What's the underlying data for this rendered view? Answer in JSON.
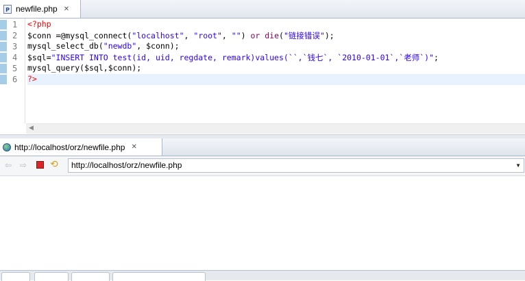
{
  "editor": {
    "tab_label": "newfile.php",
    "line_numbers": [
      "1",
      "2",
      "3",
      "4",
      "5",
      "6"
    ],
    "code": {
      "l1_tag": "<?php",
      "l2_a": "$conn =@mysql_connect(",
      "l2_s1": "\"localhost\"",
      "l2_b": ", ",
      "l2_s2": "\"root\"",
      "l2_c": ", ",
      "l2_s3": "\"\"",
      "l2_d": ") ",
      "l2_kw": "or die",
      "l2_e": "(",
      "l2_s4": "\"链接错误\"",
      "l2_f": ");",
      "l3_a": "mysql_select_db(",
      "l3_s1": "\"newdb\"",
      "l3_b": ", $conn);",
      "l4_a": "$sql=",
      "l4_s1": "\"INSERT INTO test(id, uid, regdate, remark)values(``,`钱七`, `2010-01-01`,`老师`)\"",
      "l4_b": ";",
      "l5": "mysql_query($sql,$conn);",
      "l6_tag": "?>"
    }
  },
  "browser": {
    "tab_label": "http://localhost/orz/newfile.php",
    "url": "http://localhost/orz/newfile.php"
  },
  "icons": {
    "editor_tab": "php-file-icon",
    "browser_tab": "globe-icon",
    "back": "back-arrow-icon",
    "forward": "forward-arrow-icon",
    "stop": "stop-icon",
    "refresh": "refresh-icon"
  },
  "colors": {
    "keyword": "#7f0055",
    "string": "#2a00ff",
    "php_tag": "#ff0000",
    "current_line": "#e8f2fe"
  }
}
